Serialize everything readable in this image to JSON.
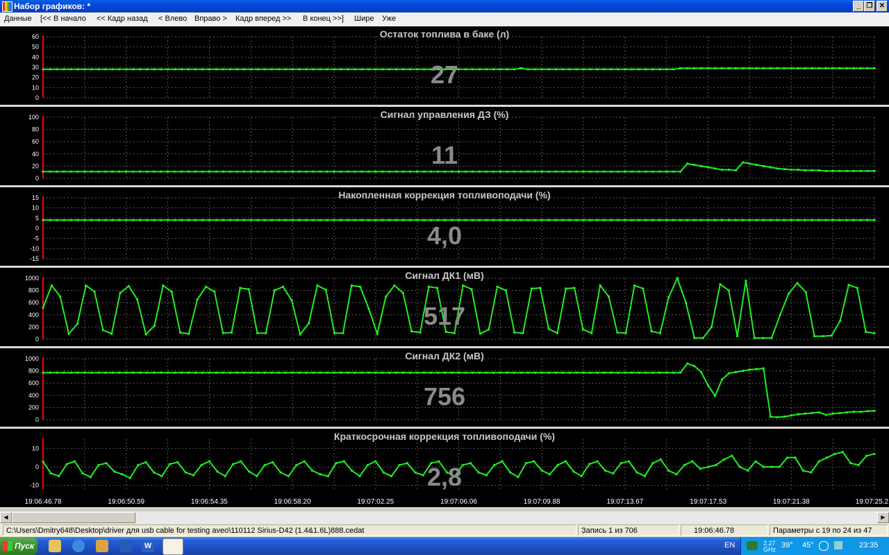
{
  "window": {
    "title": "Набор графиков: *",
    "buttons": {
      "minimize": "_",
      "restore": "❐",
      "close": "✕"
    }
  },
  "menu": [
    {
      "label": "Данные"
    },
    {
      "label": "[<< В начало"
    },
    {
      "label": "<< Кадр назад"
    },
    {
      "label": "< Влево"
    },
    {
      "label": "Вправо >"
    },
    {
      "label": "Кадр вперед >>"
    },
    {
      "label": "В конец >>]"
    },
    {
      "label": "Шире"
    },
    {
      "label": "Уже"
    }
  ],
  "colors": {
    "plot_background": "#000000",
    "grid": "#5a5a5a",
    "series": "#22ee22",
    "cursor": "#ff0000",
    "big_value": "#8a8a8a"
  },
  "chart_data": [
    {
      "type": "line",
      "title": "Остаток топлива в баке  (л)",
      "current_value": "27",
      "ylim": [
        0,
        60
      ],
      "yticks": [
        0,
        10,
        20,
        30,
        40,
        50,
        60
      ],
      "values": [
        28,
        28,
        28,
        28,
        28,
        28,
        28,
        28,
        28,
        28,
        28,
        28,
        28,
        28,
        28,
        28,
        28,
        28,
        28,
        28,
        28,
        28,
        28,
        28,
        28,
        28,
        28,
        28,
        28,
        28,
        28,
        28,
        28,
        28,
        28,
        28,
        28,
        28,
        28,
        28,
        28,
        28,
        28,
        28,
        28,
        28,
        28,
        28,
        28,
        28,
        28,
        28,
        28,
        28,
        28,
        28,
        28,
        28,
        28,
        28,
        28,
        28,
        28,
        28,
        28,
        28,
        28,
        28,
        28,
        29,
        28,
        28,
        28,
        28,
        28,
        28,
        28,
        28,
        28,
        28,
        28,
        28,
        28,
        28,
        28,
        28,
        28,
        28,
        28,
        28,
        28,
        28,
        29,
        29,
        29,
        29,
        29,
        29,
        29,
        29,
        29,
        29,
        29,
        29,
        29,
        29,
        29,
        29,
        29,
        29,
        29,
        29,
        29,
        29,
        29,
        29,
        29,
        29,
        29,
        29,
        29
      ]
    },
    {
      "type": "line",
      "title": "Сигнал управления ДЗ  (%)",
      "current_value": "11",
      "ylim": [
        0,
        100
      ],
      "yticks": [
        0,
        20,
        40,
        60,
        80,
        100
      ],
      "values": [
        11,
        11,
        11,
        11,
        11,
        11,
        11,
        11,
        11,
        11,
        11,
        11,
        11,
        11,
        11,
        11,
        11,
        11,
        11,
        11,
        11,
        11,
        11,
        11,
        11,
        11,
        11,
        11,
        11,
        11,
        11,
        11,
        11,
        11,
        11,
        11,
        11,
        11,
        11,
        11,
        11,
        11,
        11,
        11,
        11,
        11,
        11,
        11,
        11,
        11,
        11,
        11,
        11,
        11,
        11,
        11,
        11,
        11,
        11,
        11,
        11,
        11,
        11,
        11,
        11,
        11,
        11,
        11,
        11,
        11,
        11,
        11,
        11,
        11,
        11,
        11,
        11,
        11,
        11,
        11,
        11,
        11,
        11,
        11,
        11,
        11,
        11,
        11,
        11,
        11,
        11,
        11,
        11,
        24,
        22,
        20,
        18,
        16,
        14,
        14,
        13,
        26,
        24,
        22,
        20,
        18,
        16,
        15,
        14,
        14,
        13,
        13,
        13,
        12,
        12,
        12,
        12,
        12,
        12,
        12,
        12
      ]
    },
    {
      "type": "line",
      "title": "Накопленная коррекция топливоподачи  (%)",
      "current_value": "4,0",
      "ylim": [
        -15,
        15
      ],
      "yticks": [
        -15,
        -10,
        -5,
        0,
        5,
        10,
        15
      ],
      "values": [
        4,
        4,
        4,
        4,
        4,
        4,
        4,
        4,
        4,
        4,
        4,
        4,
        4,
        4,
        4,
        4,
        4,
        4,
        4,
        4,
        4,
        4,
        4,
        4,
        4,
        4,
        4,
        4,
        4,
        4,
        4,
        4,
        4,
        4,
        4,
        4,
        4,
        4,
        4,
        4,
        4,
        4,
        4,
        4,
        4,
        4,
        4,
        4,
        4,
        4,
        4,
        4,
        4,
        4,
        4,
        4,
        4,
        4,
        4,
        4,
        4,
        4,
        4,
        4,
        4,
        4,
        4,
        4,
        4,
        4,
        4,
        4,
        4,
        4,
        4,
        4,
        4,
        4,
        4,
        4,
        4,
        4,
        4,
        4,
        4,
        4,
        4,
        4,
        4,
        4,
        4,
        4,
        4,
        4,
        4,
        4,
        4,
        4,
        4,
        4,
        4,
        4,
        4,
        4,
        4,
        4,
        4,
        4,
        4,
        4,
        4,
        4,
        4,
        4,
        4,
        4,
        4,
        4,
        4,
        4,
        4
      ]
    },
    {
      "type": "line",
      "title": "Сигнал ДК1  (мВ)",
      "current_value": "517",
      "ylim": [
        0,
        1000
      ],
      "yticks": [
        0,
        200,
        400,
        600,
        800,
        1000
      ],
      "values": [
        517,
        880,
        700,
        90,
        250,
        880,
        780,
        150,
        90,
        760,
        870,
        650,
        80,
        220,
        880,
        780,
        110,
        90,
        650,
        860,
        780,
        100,
        110,
        840,
        820,
        100,
        100,
        800,
        860,
        640,
        80,
        260,
        880,
        810,
        100,
        100,
        880,
        860,
        500,
        90,
        700,
        880,
        760,
        130,
        110,
        860,
        840,
        120,
        100,
        880,
        820,
        90,
        160,
        860,
        800,
        110,
        100,
        830,
        840,
        170,
        100,
        830,
        840,
        160,
        100,
        880,
        700,
        110,
        100,
        880,
        830,
        130,
        100,
        690,
        1000,
        600,
        20,
        20,
        200,
        900,
        800,
        50,
        960,
        20,
        20,
        20,
        400,
        750,
        920,
        770,
        50,
        50,
        60,
        300,
        890,
        840,
        120,
        100
      ],
      "x_count_override": 98
    },
    {
      "type": "line",
      "title": "Сигнал ДК2  (мВ)",
      "current_value": "756",
      "ylim": [
        0,
        1000
      ],
      "yticks": [
        0,
        200,
        400,
        600,
        800,
        1000
      ],
      "values": [
        770,
        770,
        770,
        770,
        770,
        770,
        770,
        770,
        770,
        770,
        770,
        770,
        770,
        770,
        770,
        770,
        770,
        770,
        770,
        770,
        770,
        770,
        770,
        770,
        770,
        770,
        770,
        770,
        770,
        770,
        770,
        770,
        770,
        770,
        770,
        770,
        770,
        770,
        770,
        770,
        770,
        770,
        770,
        770,
        770,
        770,
        770,
        770,
        770,
        770,
        770,
        770,
        770,
        770,
        770,
        770,
        770,
        770,
        770,
        770,
        770,
        770,
        770,
        770,
        770,
        770,
        770,
        770,
        770,
        770,
        770,
        770,
        770,
        770,
        770,
        770,
        770,
        770,
        770,
        770,
        770,
        770,
        770,
        770,
        770,
        770,
        770,
        770,
        770,
        770,
        770,
        770,
        770,
        920,
        880,
        780,
        560,
        390,
        660,
        760,
        780,
        800,
        820,
        830,
        840,
        50,
        40,
        50,
        70,
        90,
        100,
        110,
        120,
        80,
        100,
        110,
        120,
        130,
        130,
        140,
        145
      ]
    },
    {
      "type": "line",
      "title": "Краткосрочная коррекция топливоподачи  (%)",
      "current_value": "2,8",
      "ylim": [
        -12,
        15
      ],
      "yticks": [
        -10,
        0,
        10
      ],
      "values": [
        2.8,
        -3.5,
        -5,
        1.5,
        3,
        -3.5,
        -5.5,
        1,
        2,
        -2.5,
        -4,
        -6,
        1,
        2.5,
        -3,
        -5,
        1.5,
        2.5,
        -3,
        -4.5,
        1,
        3,
        -2.5,
        -5,
        1.5,
        3,
        -2.5,
        -5,
        1,
        2.5,
        -3,
        -5,
        1,
        3,
        -2,
        -4,
        -5,
        2,
        3,
        -2,
        -5,
        1,
        3,
        -3,
        -5,
        1,
        2,
        -3,
        -4.5,
        2,
        3,
        -3,
        -5,
        1,
        2,
        -3,
        -4.5,
        1,
        3,
        -3,
        -5.5,
        2,
        3,
        -2,
        -4,
        1,
        3,
        -2.5,
        -5,
        1.5,
        3,
        -2,
        -3.5,
        2,
        3,
        -3,
        -5,
        2,
        4,
        -2,
        -4,
        1,
        3,
        -1,
        0,
        1,
        4,
        6,
        0,
        -2,
        3,
        0,
        0,
        0,
        5,
        5,
        -2,
        -3,
        3,
        5,
        7,
        8,
        2,
        1,
        6,
        7
      ]
    }
  ],
  "time_axis": [
    "19:06:46.78",
    "19:06:50.59",
    "19:06:54.35",
    "19:06:58.20",
    "19:07:02.25",
    "19:07:06.06",
    "19:07:09.88",
    "19:07:13.67",
    "19:07:17.53",
    "19:07:21.38",
    "19:07:25.2"
  ],
  "statusbar": {
    "file": "C:\\Users\\Dmitry648\\Desktop\\driver для usb cable for testing aveo\\110112 Sirius-D42 (1.4&1.6L)888.cedat",
    "record": "Запись 1 из 706",
    "time": "19:06:46.78",
    "params": "Параметры с 19 по 24 из 47"
  },
  "taskbar": {
    "start_label": "Пуск",
    "lang": "EN",
    "cpu_freq": "2.27 GHz",
    "temp1": "39°",
    "temp2": "45°",
    "clock": "23:35"
  }
}
